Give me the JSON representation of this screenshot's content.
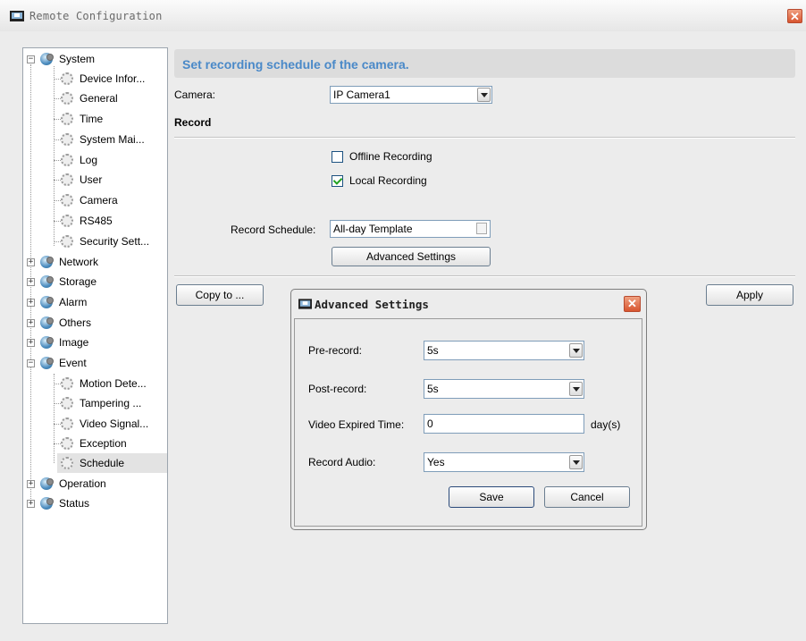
{
  "window": {
    "title": "Remote Configuration",
    "close_glyph": "✕"
  },
  "tree": {
    "system": "System",
    "system_items": [
      "Device Infor...",
      "General",
      "Time",
      "System Mai...",
      "Log",
      "User",
      "Camera",
      "RS485",
      "Security Sett..."
    ],
    "network": "Network",
    "storage": "Storage",
    "alarm": "Alarm",
    "others": "Others",
    "image": "Image",
    "event": "Event",
    "event_items": [
      "Motion Dete...",
      "Tampering ...",
      "Video Signal...",
      "Exception",
      "Schedule"
    ],
    "operation": "Operation",
    "status": "Status",
    "expand_glyph": "+",
    "collapse_glyph": "−"
  },
  "main": {
    "heading": "Set recording schedule of the camera.",
    "camera_label": "Camera:",
    "camera_value": "IP Camera1",
    "record_label": "Record",
    "offline_label": "Offline Recording",
    "offline_checked": false,
    "local_label": "Local Recording",
    "local_checked": true,
    "schedule_label": "Record Schedule:",
    "schedule_value": "All-day Template",
    "advanced_btn": "Advanced Settings",
    "copy_btn": "Copy to ...",
    "apply_btn": "Apply"
  },
  "dialog": {
    "title": "Advanced Settings",
    "close_glyph": "✕",
    "prerecord_label": "Pre-record:",
    "prerecord_value": "5s",
    "postrecord_label": "Post-record:",
    "postrecord_value": "5s",
    "expired_label": "Video Expired Time:",
    "expired_value": "0",
    "expired_unit": "day(s)",
    "audio_label": "Record Audio:",
    "audio_value": "Yes",
    "save_btn": "Save",
    "cancel_btn": "Cancel"
  },
  "colors": {
    "accent": "#4a89c8",
    "close": "#d8552f",
    "selected_row": "#e3e3e3"
  }
}
